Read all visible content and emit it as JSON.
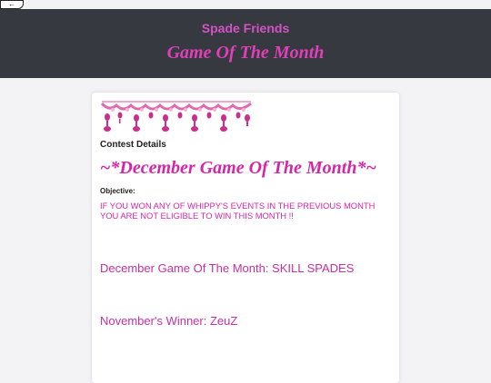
{
  "nav": {
    "back_label": "←",
    "back_icon": "back-arrow-icon"
  },
  "header": {
    "site_name": "Spade Friends",
    "page_title": "Game Of The Month"
  },
  "card": {
    "banner_icon": "pink-bead-garland-decoration",
    "contest_details_label": "Contest Details",
    "contest_title": "~*December Game Of The Month*~",
    "objective_label": "Objective:",
    "objective_text": "IF YOU WON ANY OF WHIPPY'S EVENTS IN THE PREVIOUS MONTH YOU ARE NOT ELIGIBLE TO WIN THIS MONTH !!",
    "game_of_month_line": "December Game Of The Month: SKILL SPADES",
    "winner_line": "November's Winner: ZeuZ"
  },
  "colors": {
    "header_bg": "#363a40",
    "accent_pink": "#d426a8",
    "site_name_pink": "#d451c4",
    "page_bg": "#f3f3f5"
  }
}
